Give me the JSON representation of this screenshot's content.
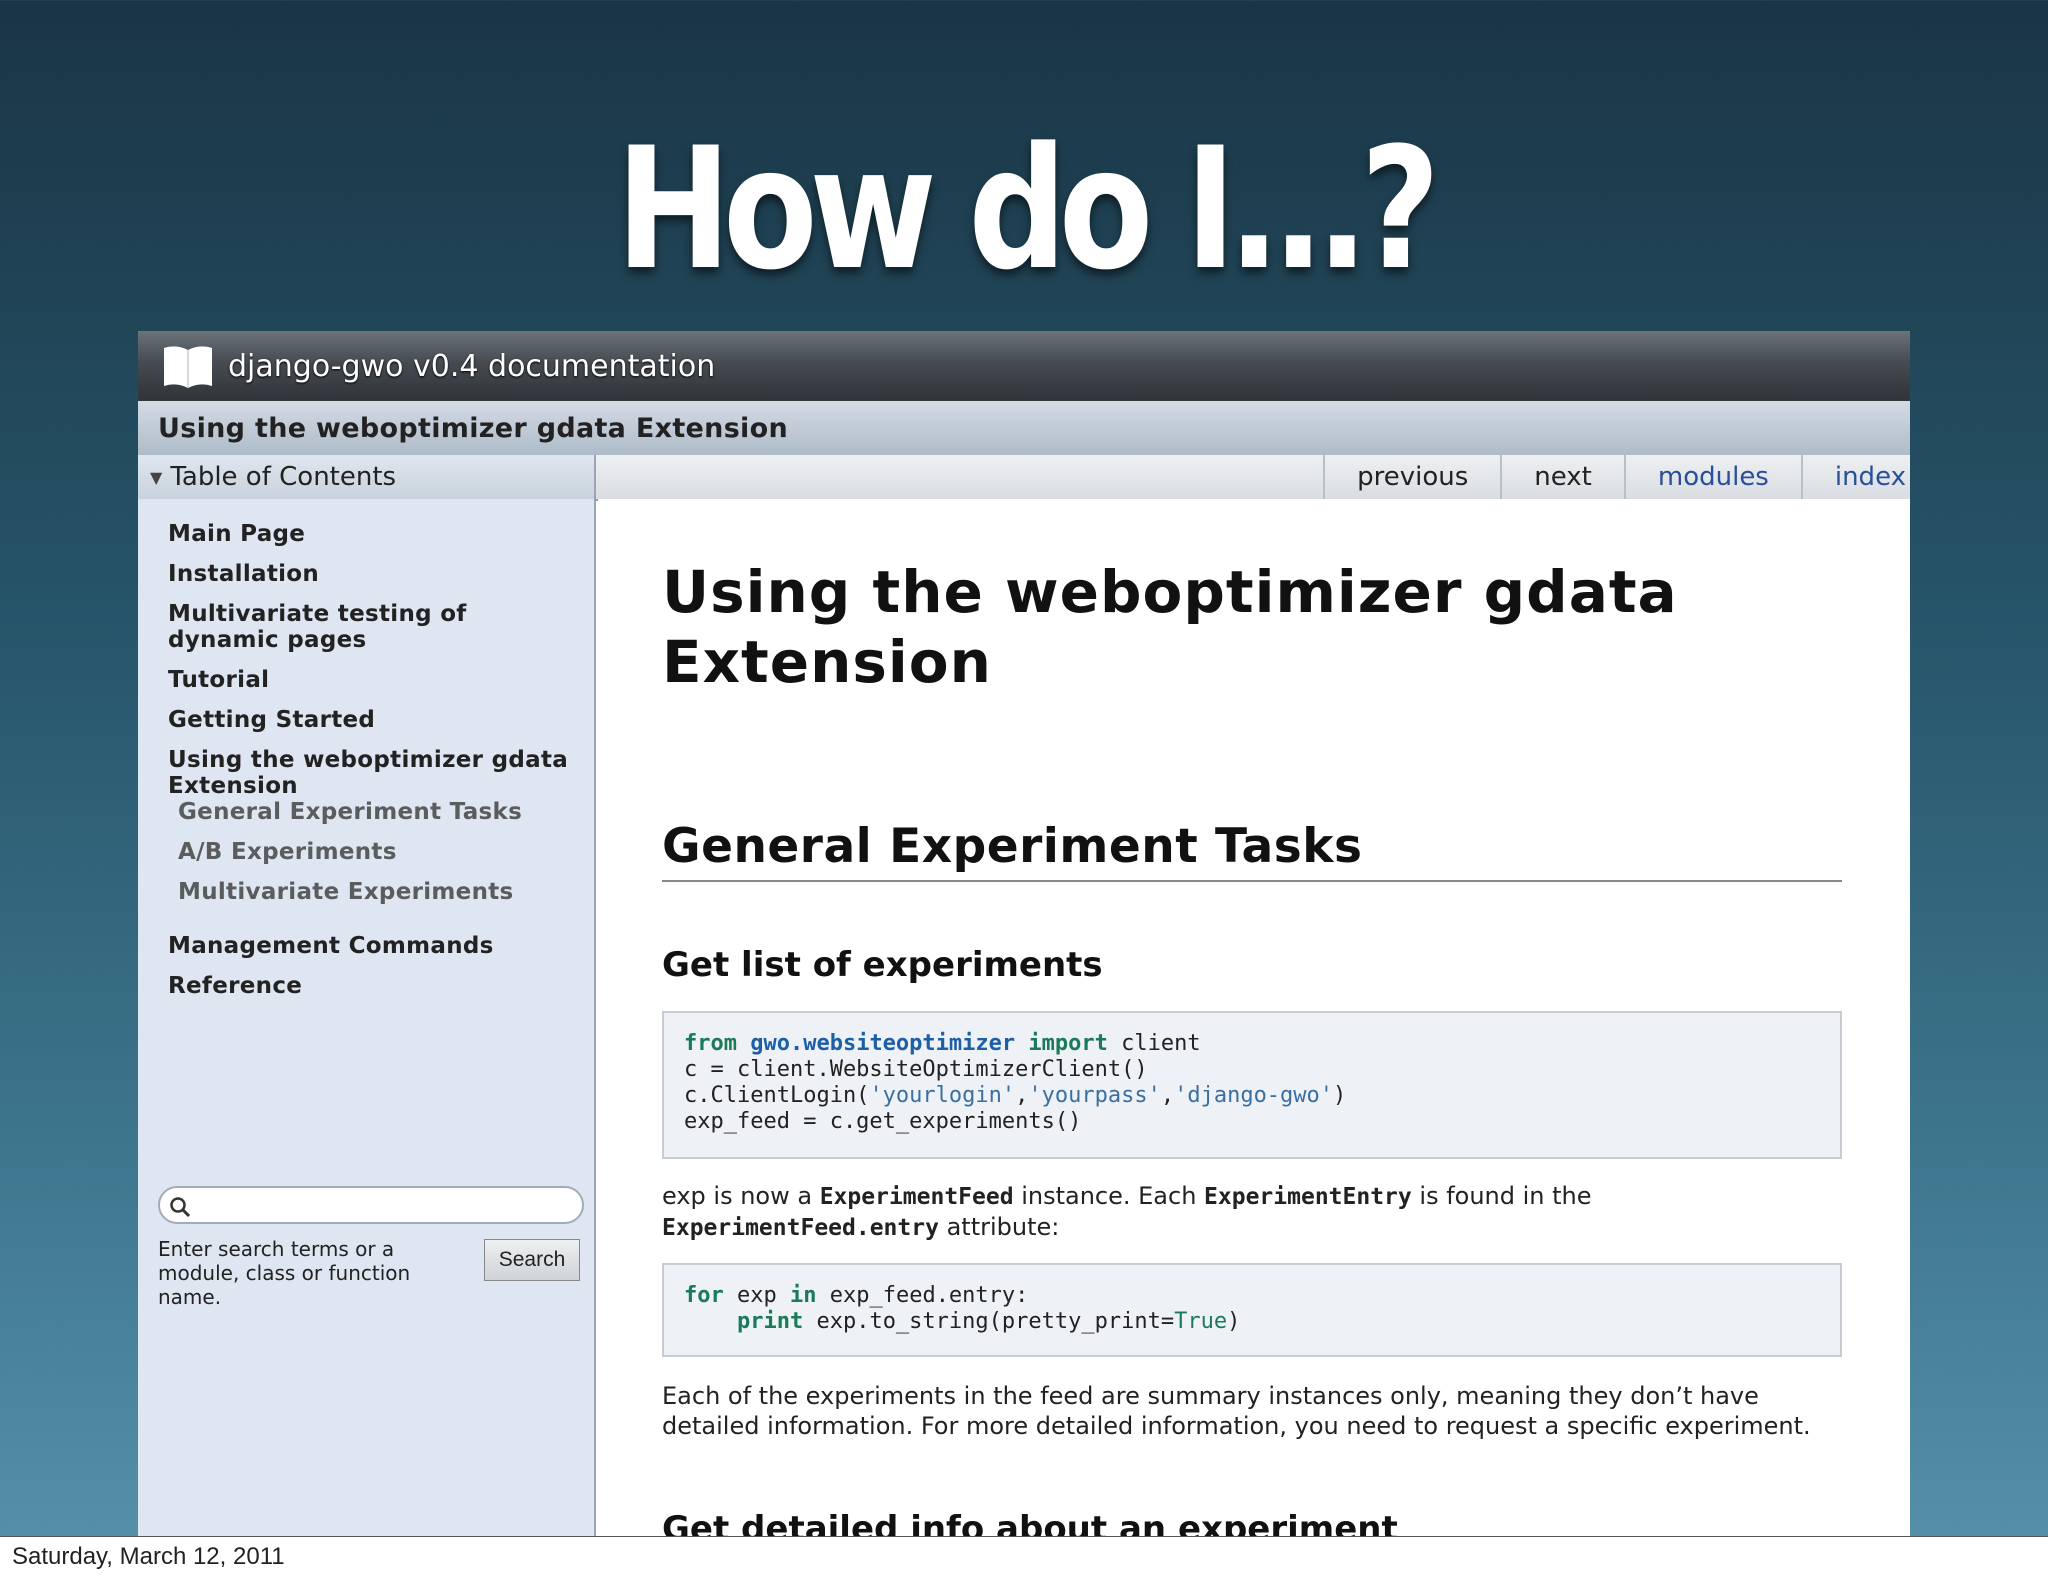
{
  "slide": {
    "title": "How do I...?",
    "footer_date": "Saturday, March 12, 2011"
  },
  "browser": {
    "doc_title": "django-gwo v0.4 documentation",
    "page_heading": "Using the weboptimizer gdata Extension",
    "toc_label": "Table of Contents",
    "nav": {
      "previous": "previous",
      "next": "next",
      "modules": "modules",
      "index": "index"
    },
    "sidebar": {
      "items": [
        {
          "label": "Main Page"
        },
        {
          "label": "Installation"
        },
        {
          "label": "Multivariate testing of dynamic pages"
        },
        {
          "label": "Tutorial"
        },
        {
          "label": "Getting Started"
        },
        {
          "label": "Using the weboptimizer gdata Extension"
        }
      ],
      "subitems": [
        {
          "label": "General Experiment Tasks"
        },
        {
          "label": "A/B Experiments"
        },
        {
          "label": "Multivariate Experiments"
        }
      ],
      "items_after": [
        {
          "label": "Management Commands"
        },
        {
          "label": "Reference"
        }
      ],
      "search": {
        "placeholder": "",
        "help": "Enter search terms or a module, class or function name.",
        "button": "Search"
      }
    },
    "content": {
      "h1": "Using the weboptimizer gdata Extension",
      "h2": "General Experiment Tasks",
      "h3": "Get list of experiments",
      "code1": {
        "l1_kw1": "from",
        "l1_mod": "gwo.websiteoptimizer",
        "l1_kw2": "import",
        "l1_rest": " client",
        "l2": "c = client.WebsiteOptimizerClient()",
        "l3_pre": "c.ClientLogin(",
        "l3_s1": "'yourlogin'",
        "l3_c1": ",",
        "l3_s2": "'yourpass'",
        "l3_c2": ",",
        "l3_s3": "'django-gwo'",
        "l3_post": ")",
        "l4": "exp_feed = c.get_experiments()"
      },
      "para1": {
        "t1": "exp is now a ",
        "b1": "ExperimentFeed",
        "t2": " instance. Each ",
        "b2": "ExperimentEntry",
        "t3": " is found in the",
        "b3": "ExperimentFeed.entry",
        "t4": " attribute:"
      },
      "code2": {
        "l1_kw1": "for",
        "l1_mid": " exp ",
        "l1_kw2": "in",
        "l1_rest": " exp_feed.entry:",
        "l2_indent": "    ",
        "l2_kw": "print",
        "l2_mid": " exp.to_string(pretty_print=",
        "l2_val": "True",
        "l2_end": ")"
      },
      "para2": "Each of the experiments in the feed are summary instances only, meaning they don’t have detailed information. For more detailed information, you need to request a specific experiment.",
      "h3_cut": "Get detailed info about an experiment"
    }
  }
}
